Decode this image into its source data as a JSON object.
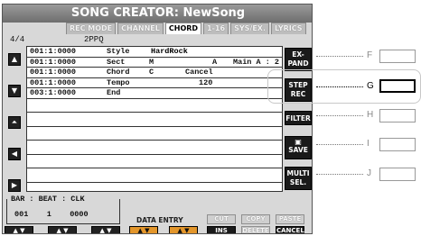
{
  "title": "SONG CREATOR: NewSong",
  "tabs": [
    {
      "label": "REC MODE"
    },
    {
      "label": "CHANNEL"
    },
    {
      "label": "CHORD"
    },
    {
      "label": "1-16"
    },
    {
      "label": "SYS/EX."
    },
    {
      "label": "LYRICS"
    }
  ],
  "time_signature": "4/4",
  "ppq": "2PPQ",
  "events": [
    {
      "time": "001:1:0000",
      "type": "Style",
      "v1": "HardRock",
      "v2": "",
      "v3": ""
    },
    {
      "time": "001:1:0000",
      "type": "Sect",
      "v1": "M",
      "v2": "A",
      "v3": "Main A  : 2"
    },
    {
      "time": "001:1:0000",
      "type": "Chord",
      "v1": "C",
      "v2": "Cancel",
      "v3": ""
    },
    {
      "time": "001:1:0000",
      "type": "Tempo",
      "v1": "",
      "v2": "120",
      "v3": ""
    },
    {
      "time": "003:1:0000",
      "type": "End",
      "v1": "",
      "v2": "",
      "v3": ""
    }
  ],
  "right_buttons": {
    "expand": "EX-\nPAND",
    "step_rec": "STEP\nREC",
    "filter": "FILTER",
    "save": "SAVE",
    "multi_sel": "MULTI\nSEL."
  },
  "bar_beat_clk": {
    "label": "BAR : BEAT : CLK",
    "values": "001    1    0000"
  },
  "data_entry_label": "DATA ENTRY",
  "soft_buttons": {
    "cut": "CUT",
    "copy": "COPY",
    "paste": "PASTE",
    "ins": "INS",
    "delete": "DELETE",
    "cancel": "CANCEL"
  },
  "callouts": [
    "F",
    "G",
    "H",
    "I",
    "J"
  ],
  "colors": {
    "accent_orange": "#e3962b",
    "selected_row": "#2b2b2b"
  }
}
